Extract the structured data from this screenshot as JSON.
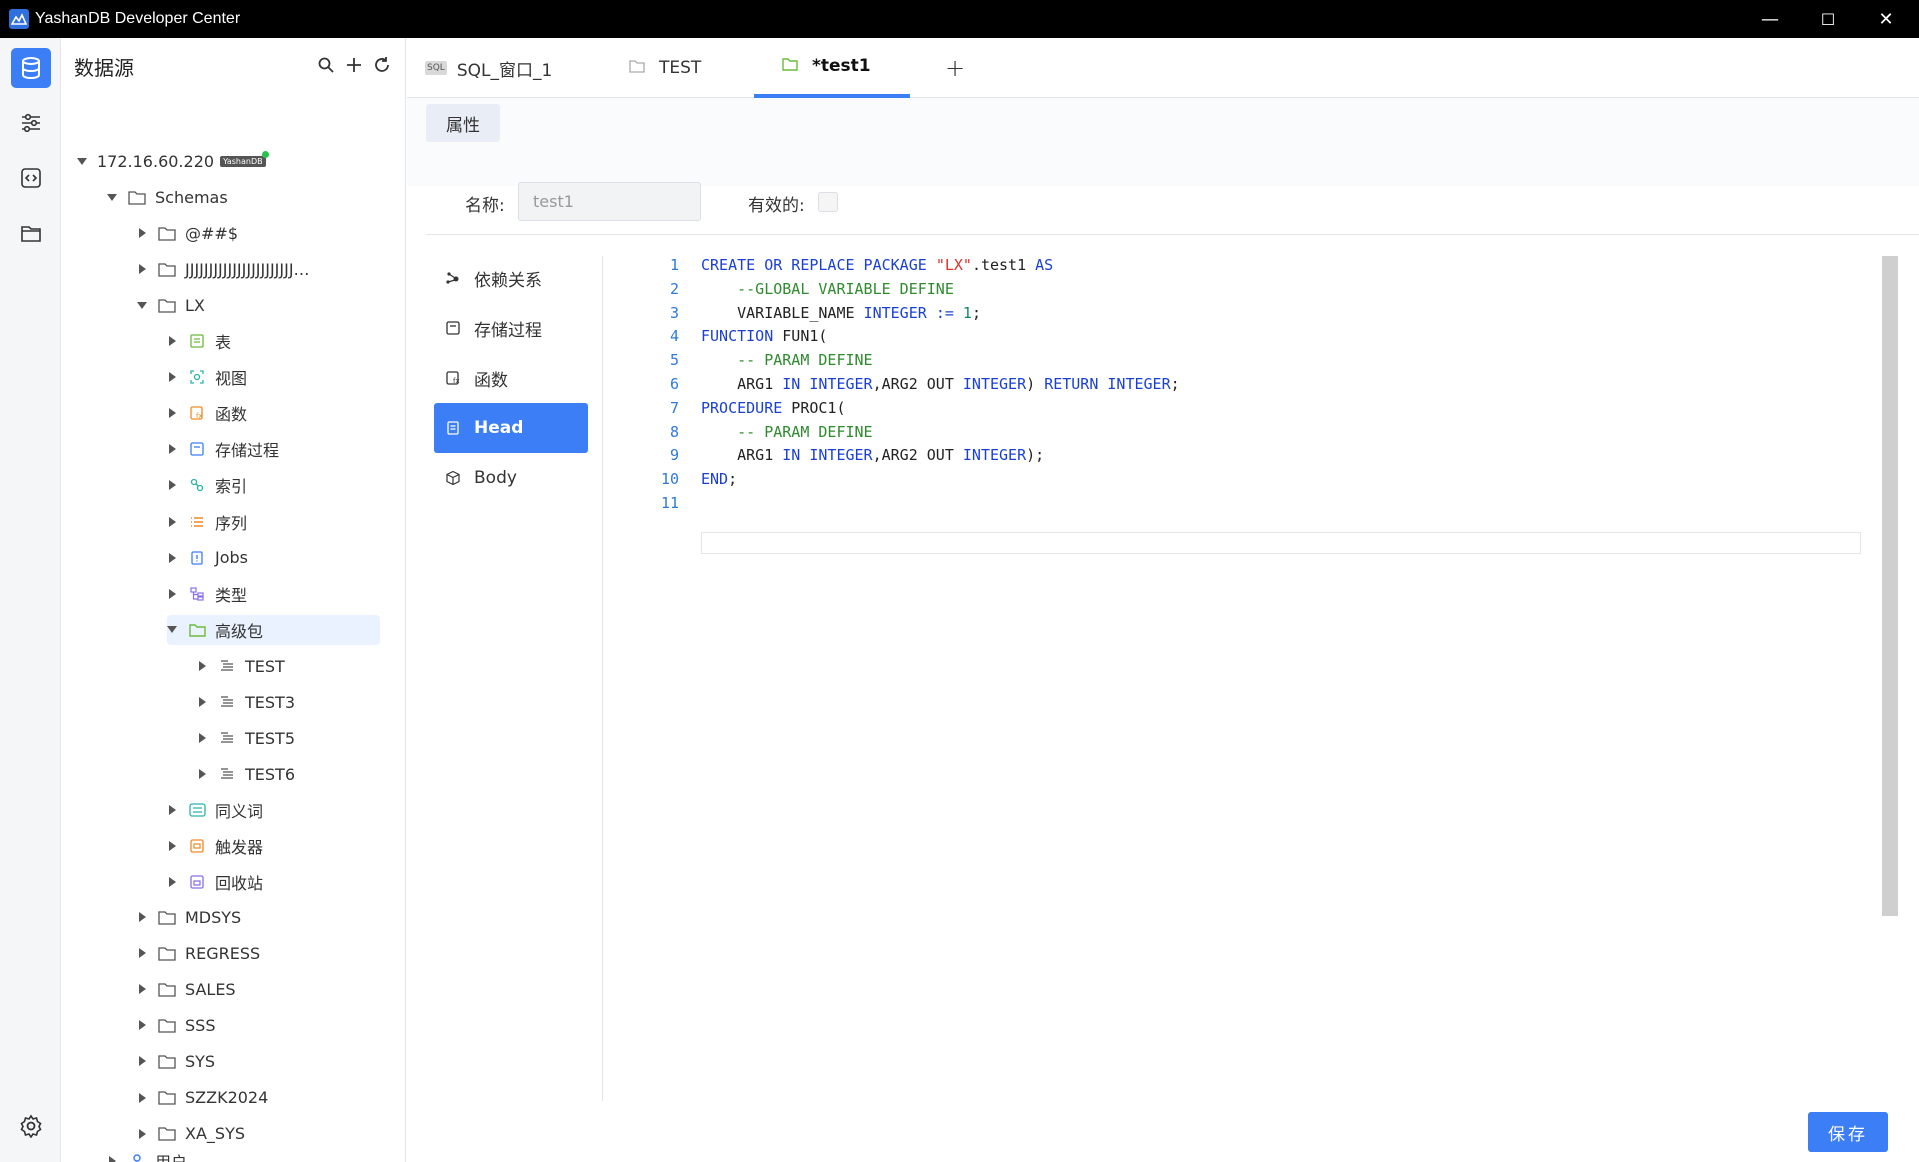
{
  "window": {
    "title": "YashanDB Developer Center",
    "minimize": "—",
    "maximize": "☐",
    "close": "✕"
  },
  "sidebar": {
    "title": "数据源",
    "server": "172.16.60.220",
    "server_badge": "YashanDB",
    "schemas_label": "Schemas",
    "schemas_top": [
      "@##$",
      "JJJJJJJJJJJJJJJJJJJJJJJ…",
      "LX"
    ],
    "lx_children": [
      "表",
      "视图",
      "函数",
      "存储过程",
      "索引",
      "序列",
      "Jobs",
      "类型",
      "高级包"
    ],
    "packages": [
      "TEST",
      "TEST3",
      "TEST5",
      "TEST6"
    ],
    "lx_children_after": [
      "同义词",
      "触发器",
      "回收站"
    ],
    "schemas_bottom": [
      "MDSYS",
      "REGRESS",
      "SALES",
      "SSS",
      "SYS",
      "SZZK2024",
      "XA_SYS"
    ],
    "users_label": "用户"
  },
  "tabs": [
    {
      "label": "SQL_窗口_1",
      "icon": "SQL"
    },
    {
      "label": "TEST"
    },
    {
      "label": "*test1"
    }
  ],
  "tab_add": "+",
  "props": {
    "tab_label": "属性",
    "name_label": "名称:",
    "name_value": "test1",
    "valid_label": "有效的:"
  },
  "sections": [
    "依赖关系",
    "存储过程",
    "函数",
    "Head",
    "Body"
  ],
  "editor": {
    "line_numbers": [
      "1",
      "2",
      "3",
      "4",
      "5",
      "6",
      "7",
      "8",
      "9",
      "10",
      "11"
    ]
  },
  "save_label": "保存"
}
